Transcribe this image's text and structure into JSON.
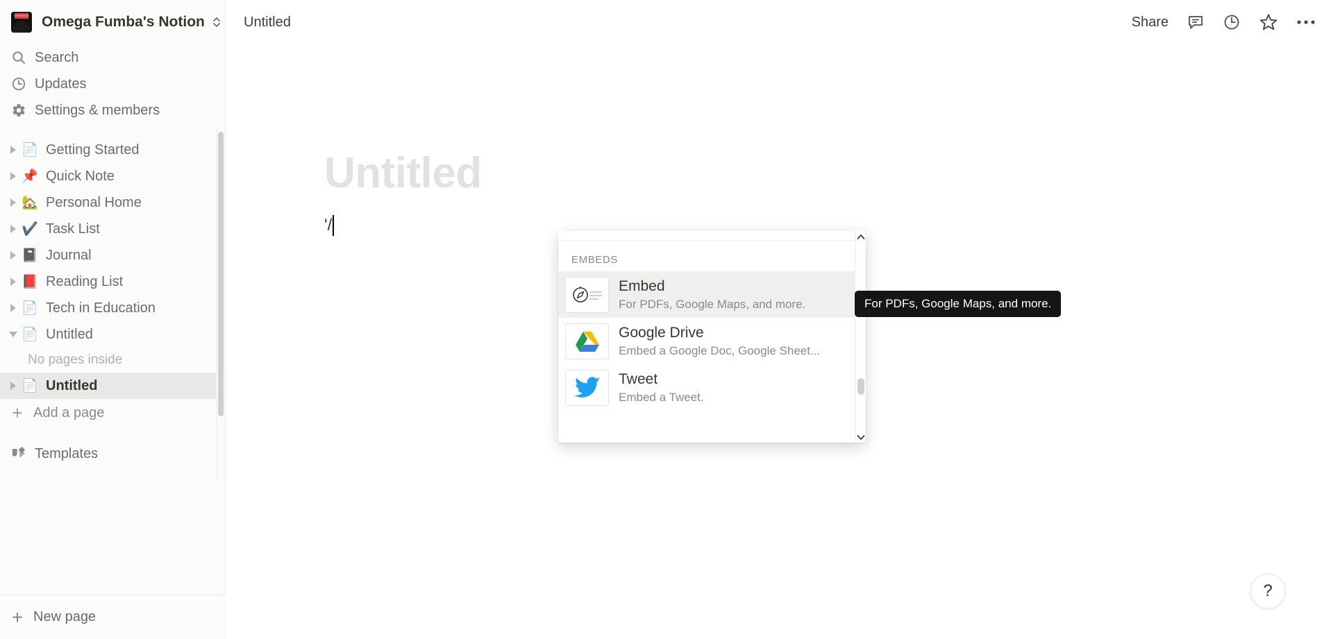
{
  "workspace": {
    "name": "Omega Fumba's Notion",
    "avatar_icon": "user-avatar",
    "switcher_icon": "chevron-up-down-icon"
  },
  "sidebar": {
    "top_links": [
      {
        "label": "Search",
        "icon": "search-icon",
        "name": "sidebar-item-search"
      },
      {
        "label": "Updates",
        "icon": "clock-icon",
        "name": "sidebar-item-updates"
      },
      {
        "label": "Settings & members",
        "icon": "gear-icon",
        "name": "sidebar-item-settings"
      }
    ],
    "pages": [
      {
        "label": "Getting Started",
        "emoji": "📄",
        "icon": "document-icon",
        "expanded": false,
        "selected": false
      },
      {
        "label": "Quick Note",
        "emoji": "📌",
        "icon": "pushpin-icon",
        "expanded": false,
        "selected": false
      },
      {
        "label": "Personal Home",
        "emoji": "🏡",
        "icon": "house-icon",
        "expanded": false,
        "selected": false
      },
      {
        "label": "Task List",
        "emoji": "✔️",
        "icon": "check-mark-icon",
        "expanded": false,
        "selected": false
      },
      {
        "label": "Journal",
        "emoji": "📓",
        "icon": "notebook-icon",
        "expanded": false,
        "selected": false
      },
      {
        "label": "Reading List",
        "emoji": "📕",
        "icon": "closed-book-icon",
        "expanded": false,
        "selected": false
      },
      {
        "label": "Tech in Education",
        "emoji": "📄",
        "icon": "document-icon",
        "expanded": false,
        "selected": false
      },
      {
        "label": "Untitled",
        "emoji": "📄",
        "icon": "document-icon",
        "expanded": true,
        "selected": false
      }
    ],
    "no_pages_inside": "No pages inside",
    "child_page": {
      "label": "Untitled",
      "emoji": "📄",
      "icon": "document-icon",
      "selected": true
    },
    "add_a_page": "Add a page",
    "templates": "Templates",
    "new_page": "New page"
  },
  "topbar": {
    "breadcrumb": "Untitled",
    "share_label": "Share",
    "icons": [
      {
        "name": "comment-icon"
      },
      {
        "name": "history-clock-icon"
      },
      {
        "name": "star-icon"
      },
      {
        "name": "more-options-icon"
      }
    ]
  },
  "document": {
    "title_placeholder": "Untitled",
    "body_text": "'/"
  },
  "slash_menu": {
    "section_label": "EMBEDS",
    "items": [
      {
        "title": "Embed",
        "description": "For PDFs, Google Maps, and more.",
        "icon": "compass-embed-icon",
        "active": true
      },
      {
        "title": "Google Drive",
        "description": "Embed a Google Doc, Google Sheet...",
        "icon": "google-drive-icon",
        "active": false
      },
      {
        "title": "Tweet",
        "description": "Embed a Tweet.",
        "icon": "twitter-bird-icon",
        "active": false
      }
    ]
  },
  "tooltip": {
    "text": "For PDFs, Google Maps, and more."
  },
  "help": {
    "label": "?"
  },
  "colors": {
    "sidebar_bg": "#fbfbfa",
    "text_primary": "#37352f",
    "text_secondary": "#6b6b69",
    "selected_row": "#e8e8e7",
    "tooltip_bg": "#151515",
    "title_placeholder": "#e3e2e0"
  }
}
